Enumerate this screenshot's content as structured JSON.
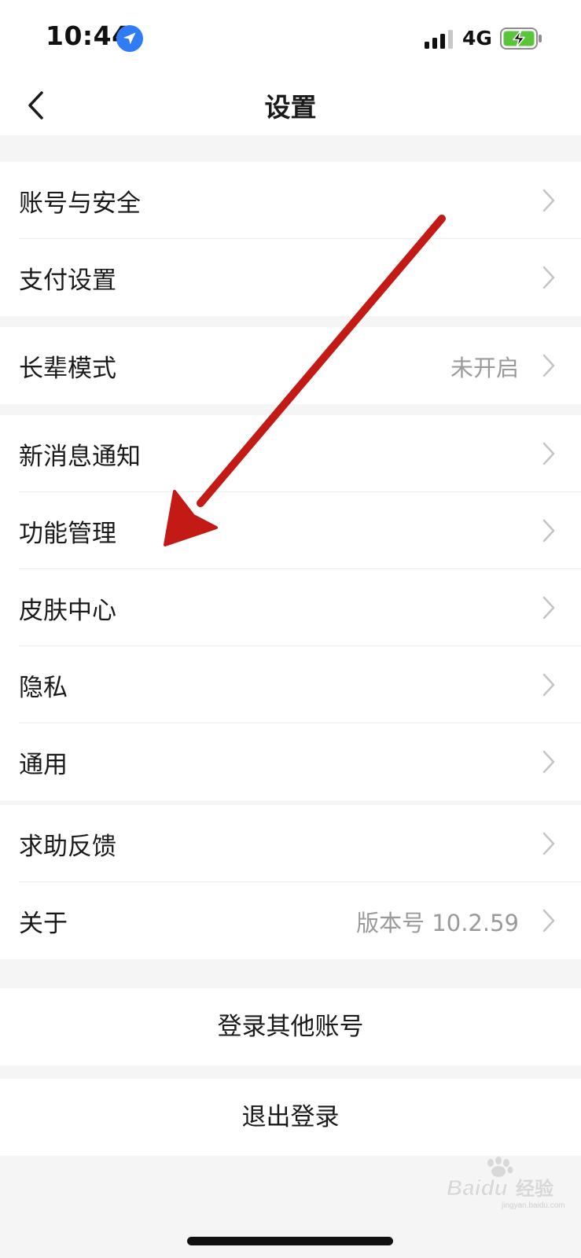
{
  "status_bar": {
    "time": "10:44",
    "network": "4G",
    "icons": [
      "location-arrow-icon",
      "signal-bars-icon",
      "battery-charging-icon"
    ],
    "location_color": "#2f7cf6",
    "battery_color": "#5ac53a"
  },
  "nav": {
    "title": "设置",
    "back_icon": "chevron-left-icon"
  },
  "groups": [
    {
      "items": [
        {
          "label": "账号与安全",
          "value": ""
        },
        {
          "label": "支付设置",
          "value": ""
        }
      ]
    },
    {
      "items": [
        {
          "label": "长辈模式",
          "value": "未开启"
        }
      ]
    },
    {
      "items": [
        {
          "label": "新消息通知",
          "value": ""
        },
        {
          "label": "功能管理",
          "value": ""
        },
        {
          "label": "皮肤中心",
          "value": ""
        },
        {
          "label": "隐私",
          "value": ""
        },
        {
          "label": "通用",
          "value": ""
        }
      ]
    },
    {
      "items": [
        {
          "label": "求助反馈",
          "value": ""
        },
        {
          "label": "关于",
          "value": "版本号 10.2.59"
        }
      ]
    }
  ],
  "actions": {
    "switch_account": "登录其他账号",
    "logout": "退出登录"
  },
  "annotation": {
    "arrow_color": "#c41a16",
    "points_to": "功能管理"
  },
  "watermark": {
    "brand": "Baidu",
    "text": "经验",
    "url": "jingyan.baidu.com"
  }
}
